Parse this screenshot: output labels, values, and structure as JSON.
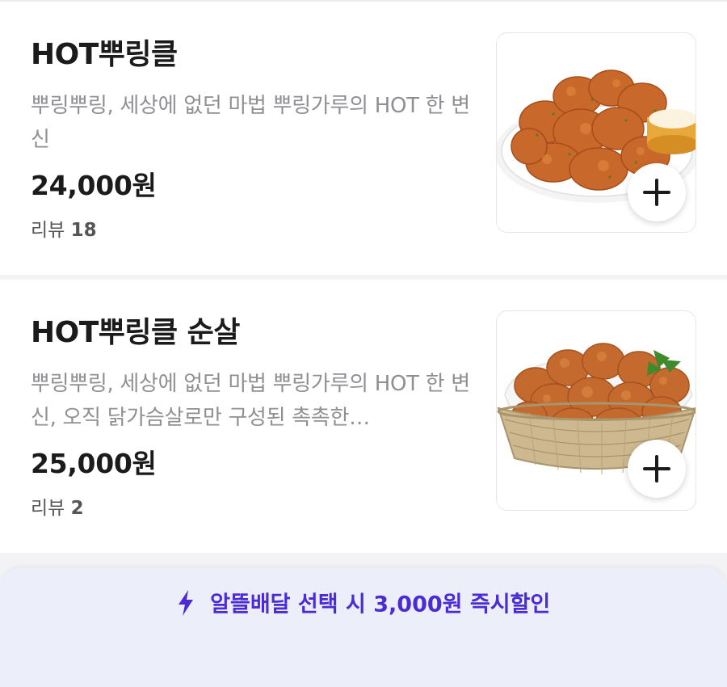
{
  "menu_items": [
    {
      "name": "HOT뿌링클",
      "description": "뿌링뿌링, 세상에 없던 마법 뿌링가루의 HOT 한 변신",
      "price": "24,000원",
      "review_label": "리뷰",
      "review_count": "18",
      "image": "fried-chicken-plate-with-dip",
      "add_icon": "plus-icon"
    },
    {
      "name": "HOT뿌링클 순살",
      "description": "뿌링뿌링, 세상에 없던 마법 뿌링가루의 HOT 한 변신, 오직 닭가슴살로만 구성된 촉촉한…",
      "price": "25,000원",
      "review_label": "리뷰",
      "review_count": "2",
      "image": "boneless-chicken-basket",
      "add_icon": "plus-icon"
    }
  ],
  "promo": {
    "icon": "lightning-bolt-icon",
    "text": "알뜰배달 선택 시 3,000원 즉시할인"
  },
  "colors": {
    "promo_text": "#4a2bd4",
    "promo_background": "#eceef9",
    "description_text": "#8f8f95",
    "chicken_crust": "#c8682a"
  }
}
